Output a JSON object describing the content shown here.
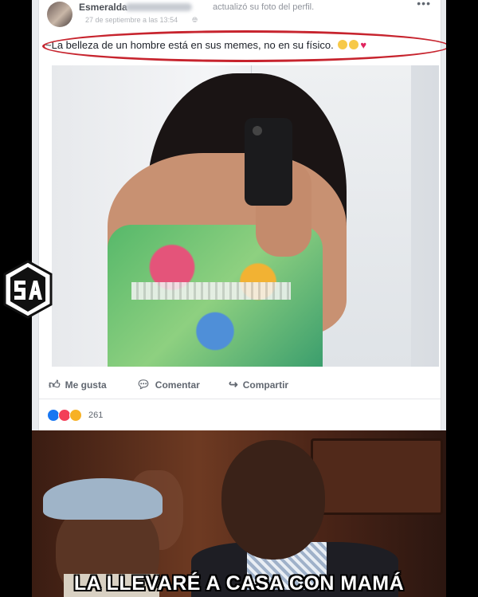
{
  "post": {
    "author": "Esmeralda",
    "action": "actualizó su foto del perfil.",
    "timestamp": "27 de septiembre a las 13:54",
    "more_icon": "•••",
    "caption": "~La belleza de un hombre está en sus memes, no en su físico.",
    "icons": {
      "globe": "globe-icon",
      "heart": "♥"
    }
  },
  "actions": {
    "like_label": "Me gusta",
    "comment_label": "Comentar",
    "share_label": "Compartir",
    "like_icon": "👍",
    "comment_icon": "💬",
    "share_icon": "↪"
  },
  "reactions": {
    "count": "261"
  },
  "meme": {
    "caption": "LA LLEVARÉ A CASA CON MAMÁ"
  },
  "watermark": {
    "logo_text": "SA"
  },
  "colors": {
    "annotation": "#c7242e",
    "facebook_blue": "#1877f2"
  }
}
